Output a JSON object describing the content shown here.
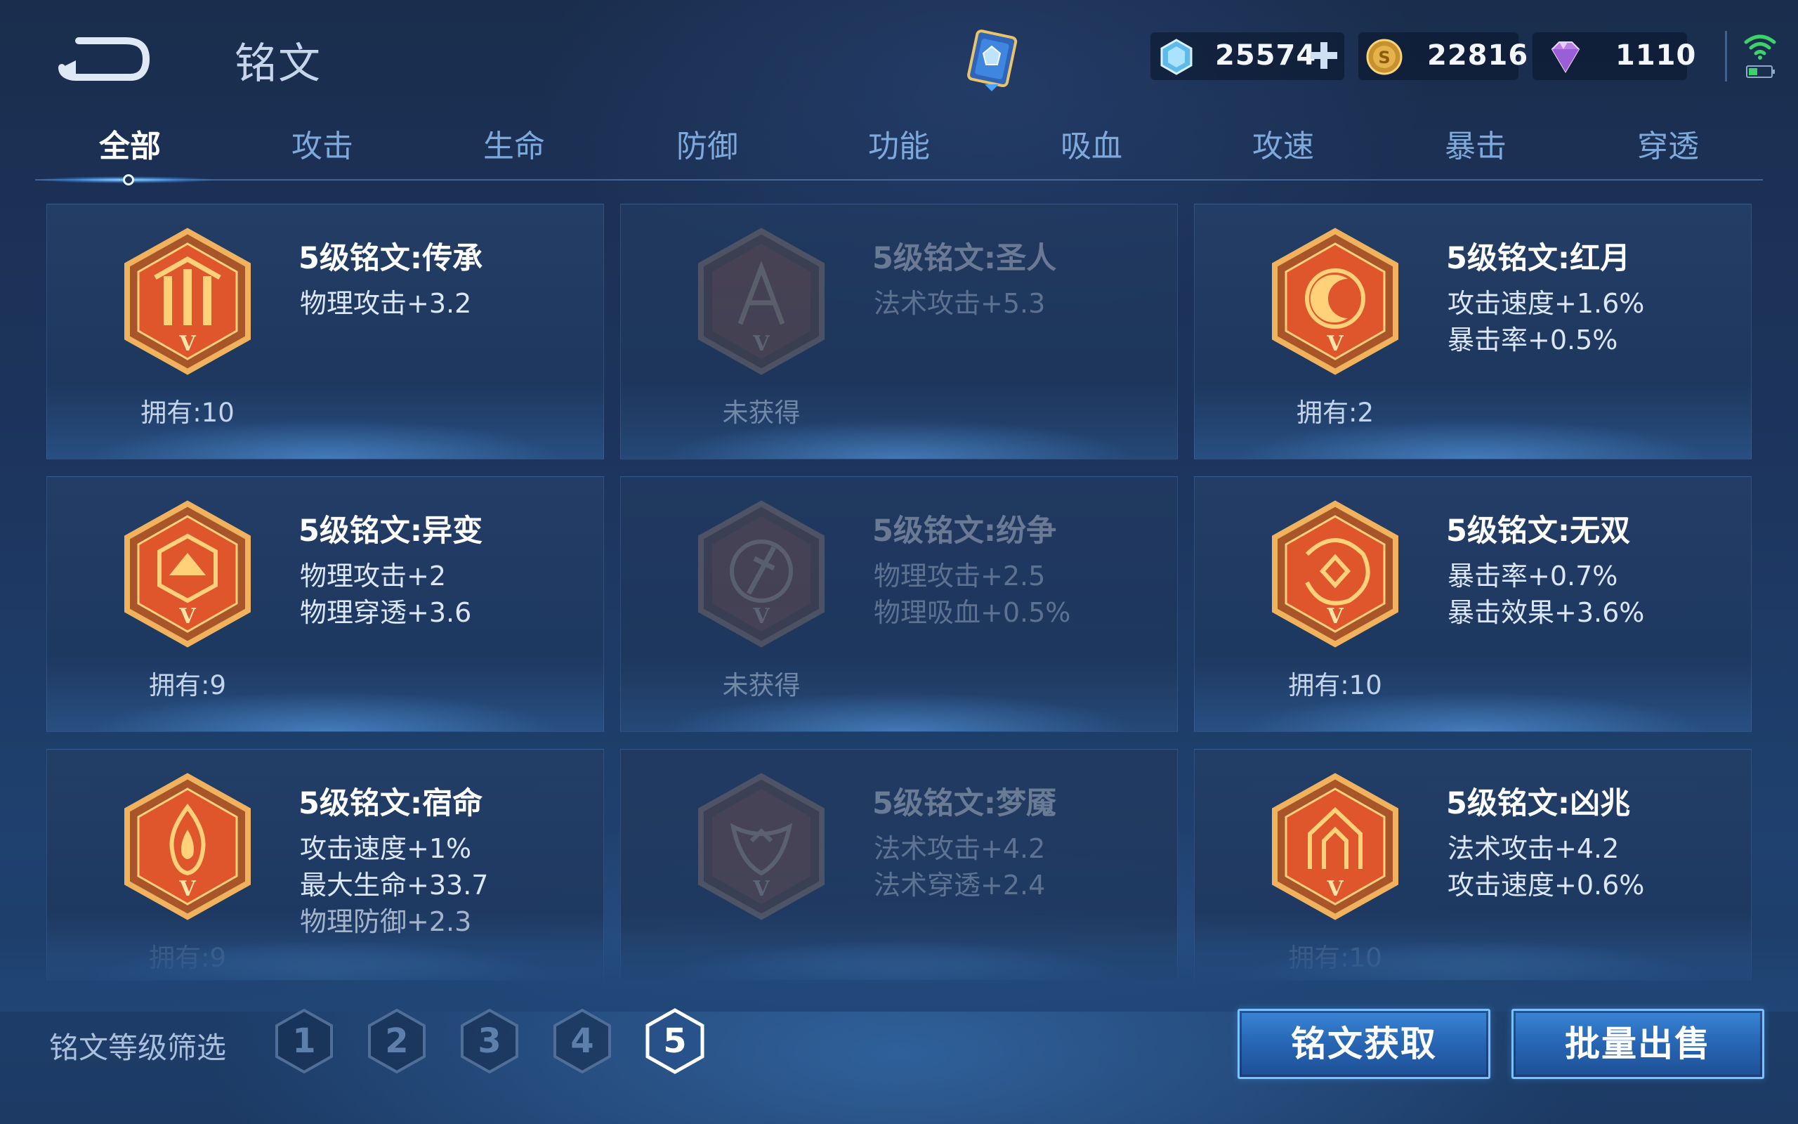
{
  "header": {
    "title": "铭文",
    "currencies": [
      {
        "icon": "diamond-icon",
        "value": "25574"
      },
      {
        "icon": "gold-coin-icon",
        "value": "22816"
      },
      {
        "icon": "gem-icon",
        "value": "1110"
      }
    ]
  },
  "tabs": [
    {
      "label": "全部",
      "active": true
    },
    {
      "label": "攻击"
    },
    {
      "label": "生命"
    },
    {
      "label": "防御"
    },
    {
      "label": "功能"
    },
    {
      "label": "吸血"
    },
    {
      "label": "攻速"
    },
    {
      "label": "暴击"
    },
    {
      "label": "穿透"
    }
  ],
  "cards": [
    {
      "name": "5级铭文:传承",
      "stats": [
        "物理攻击+3.2"
      ],
      "own": "拥有:10",
      "owned": true,
      "icon": "inheritance-rune-icon"
    },
    {
      "name": "5级铭文:圣人",
      "stats": [
        "法术攻击+5.3"
      ],
      "own": "未获得",
      "owned": false,
      "icon": "sage-rune-icon"
    },
    {
      "name": "5级铭文:红月",
      "stats": [
        "攻击速度+1.6%",
        "暴击率+0.5%"
      ],
      "own": "拥有:2",
      "owned": true,
      "icon": "red-moon-rune-icon"
    },
    {
      "name": "5级铭文:异变",
      "stats": [
        "物理攻击+2",
        "物理穿透+3.6"
      ],
      "own": "拥有:9",
      "owned": true,
      "icon": "mutation-rune-icon"
    },
    {
      "name": "5级铭文:纷争",
      "stats": [
        "物理攻击+2.5",
        "物理吸血+0.5%"
      ],
      "own": "未获得",
      "owned": false,
      "icon": "strife-rune-icon"
    },
    {
      "name": "5级铭文:无双",
      "stats": [
        "暴击率+0.7%",
        "暴击效果+3.6%"
      ],
      "own": "拥有:10",
      "owned": true,
      "icon": "peerless-rune-icon"
    },
    {
      "name": "5级铭文:宿命",
      "stats": [
        "攻击速度+1%",
        "最大生命+33.7",
        "物理防御+2.3"
      ],
      "own": "拥有:9",
      "owned": true,
      "icon": "fate-rune-icon"
    },
    {
      "name": "5级铭文:梦魇",
      "stats": [
        "法术攻击+4.2",
        "法术穿透+2.4"
      ],
      "own": "",
      "owned": false,
      "icon": "nightmare-rune-icon"
    },
    {
      "name": "5级铭文:凶兆",
      "stats": [
        "法术攻击+4.2",
        "攻击速度+0.6%"
      ],
      "own": "拥有:10",
      "owned": true,
      "icon": "omen-rune-icon"
    }
  ],
  "filter": {
    "label": "铭文等级筛选",
    "levels": [
      "1",
      "2",
      "3",
      "4",
      "5"
    ],
    "selected": "5"
  },
  "actions": {
    "obtain_label": "铭文获取",
    "sell_label": "批量出售"
  }
}
